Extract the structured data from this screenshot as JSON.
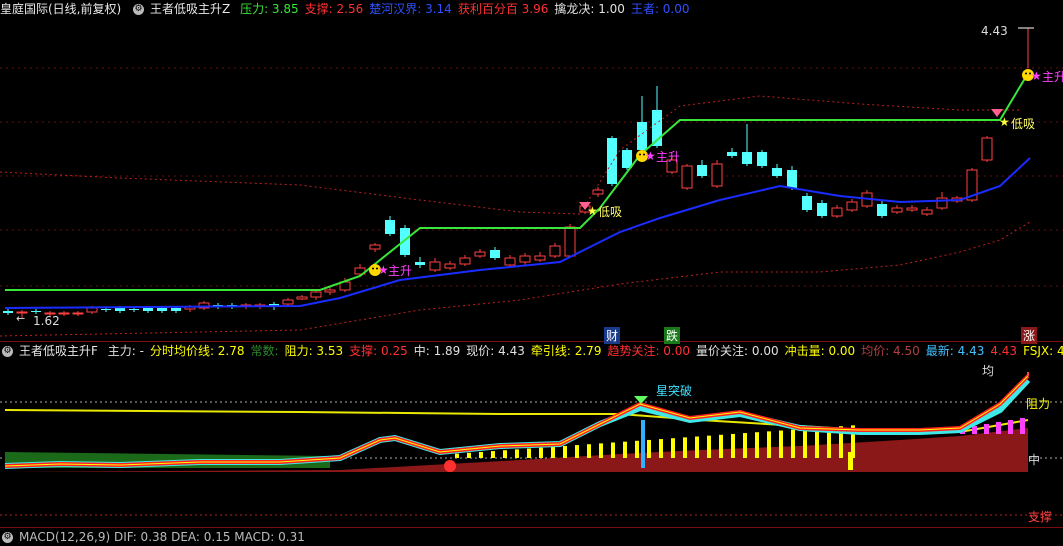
{
  "header1": {
    "symbol": "皇庭国际(日线,前复权)",
    "indicator": "王者低吸主升Z",
    "items": [
      {
        "label": "压力:",
        "value": "3.85",
        "color": "#39e639"
      },
      {
        "label": "支撑:",
        "value": "2.56",
        "color": "#ff3030"
      },
      {
        "label": "楚河汉界:",
        "value": "3.14",
        "color": "#3050ff"
      },
      {
        "label": "获利百分百",
        "value": "3.96",
        "color": "#ff3030"
      },
      {
        "label": "擒龙决:",
        "value": "1.00",
        "color": "#e0e0e0"
      },
      {
        "label": "王者:",
        "value": "0.00",
        "color": "#3050ff"
      }
    ]
  },
  "main_chart": {
    "high_label": "4.43",
    "low_label": "1.62",
    "annotations": [
      "主升",
      "低吸",
      "主升",
      "低吸",
      "主升",
      "低吸"
    ],
    "events": {
      "cai": "财",
      "die": "跌",
      "zhang": "涨"
    }
  },
  "header2": {
    "indicator": "王者低吸主升F",
    "items": [
      {
        "label": "主力:",
        "value": "-",
        "color": "#e0e0e0"
      },
      {
        "label": "分时均价线:",
        "value": "2.78",
        "color": "#ffff00"
      },
      {
        "label": "常数:",
        "value": "",
        "color": "#2a8a2a"
      },
      {
        "label": "阻力:",
        "value": "3.53",
        "color": "#ffff00"
      },
      {
        "label": "支撑:",
        "value": "0.25",
        "color": "#ff3030"
      },
      {
        "label": "中:",
        "value": "1.89",
        "color": "#e0e0e0"
      },
      {
        "label": "现价:",
        "value": "4.43",
        "color": "#e0e0e0"
      },
      {
        "label": "牵引线:",
        "value": "2.79",
        "color": "#ffff00"
      },
      {
        "label": "趋势关注:",
        "value": "0.00",
        "color": "#ff3030"
      },
      {
        "label": "量价关注:",
        "value": "0.00",
        "color": "#e0e0e0"
      },
      {
        "label": "冲击量:",
        "value": "0.00",
        "color": "#ffff00"
      },
      {
        "label": "均价:",
        "value": "4.50",
        "color": "#b04040"
      },
      {
        "label": "最新:",
        "value": "4.43",
        "color": "#40c0ff"
      },
      {
        "label": "",
        "value": "4.43",
        "color": "#ff3030"
      },
      {
        "label": "FSJX:",
        "value": "4.43",
        "color": "#ffff00"
      }
    ]
  },
  "sub_chart": {
    "labels": {
      "jun": "均",
      "zuli": "阻力",
      "zhong": "中",
      "zhicheng": "支撑",
      "breakout": "星突破"
    }
  },
  "header3": {
    "text": "MACD(12,26,9)  DIF: 0.38  DEA: 0.15  MACD: 0.31"
  }
}
